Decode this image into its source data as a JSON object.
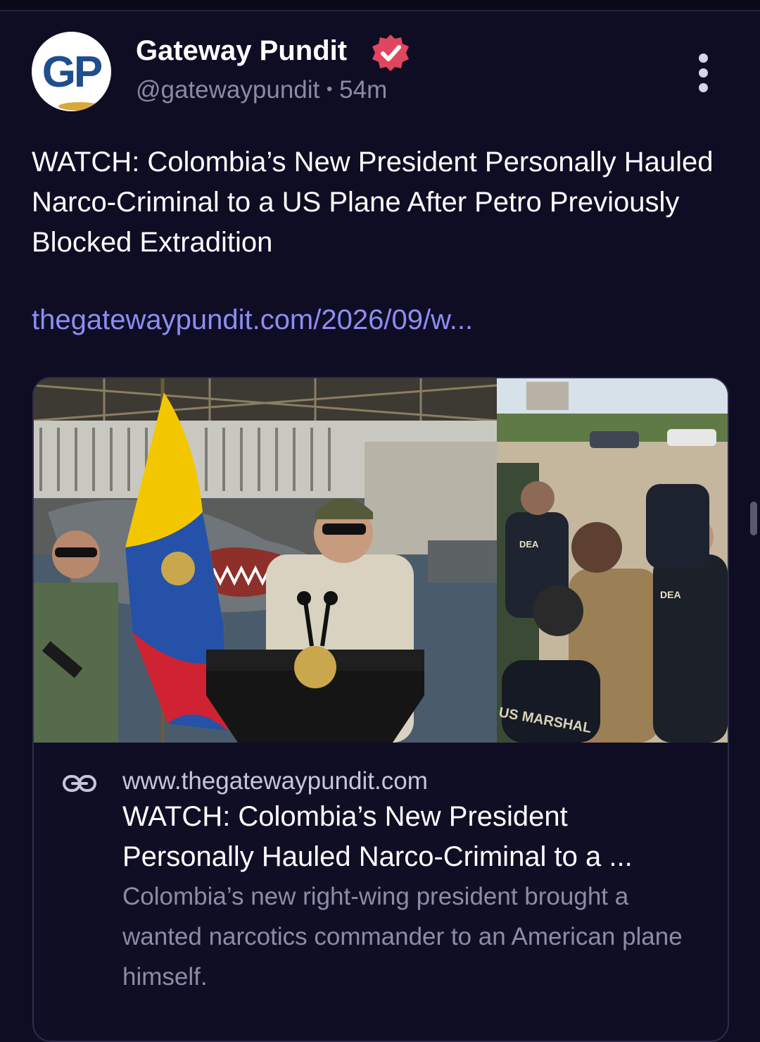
{
  "post": {
    "avatar_text": "GP",
    "display_name": "Gateway Pundit",
    "handle": "@gatewaypundit",
    "separator": "•",
    "time": "54m",
    "text": "WATCH: Colombia’s New President Personally Hauled Narco-Criminal to a US Plane After Petro Previously Blocked Extradition",
    "link": "thegatewaypundit.com/2026/09/w..."
  },
  "card": {
    "domain": "www.thegatewaypundit.com",
    "title": "WATCH: Colombia’s New President Personally Hauled Narco-Criminal to a ...",
    "description": "Colombia’s new right-wing president brought a wanted narcotics commander to an American plane himself.",
    "image_labels": {
      "dea_a": "DEA",
      "dea_b": "DEA",
      "us_marshal": "US MARSHAL"
    }
  },
  "icons": {
    "verified": "verified-badge-icon",
    "more": "more-vertical-icon",
    "link": "link-icon"
  },
  "colors": {
    "background": "#0f0d24",
    "link": "#8f8cf5",
    "verified": "#e0465f",
    "muted": "#8b8aa3"
  }
}
